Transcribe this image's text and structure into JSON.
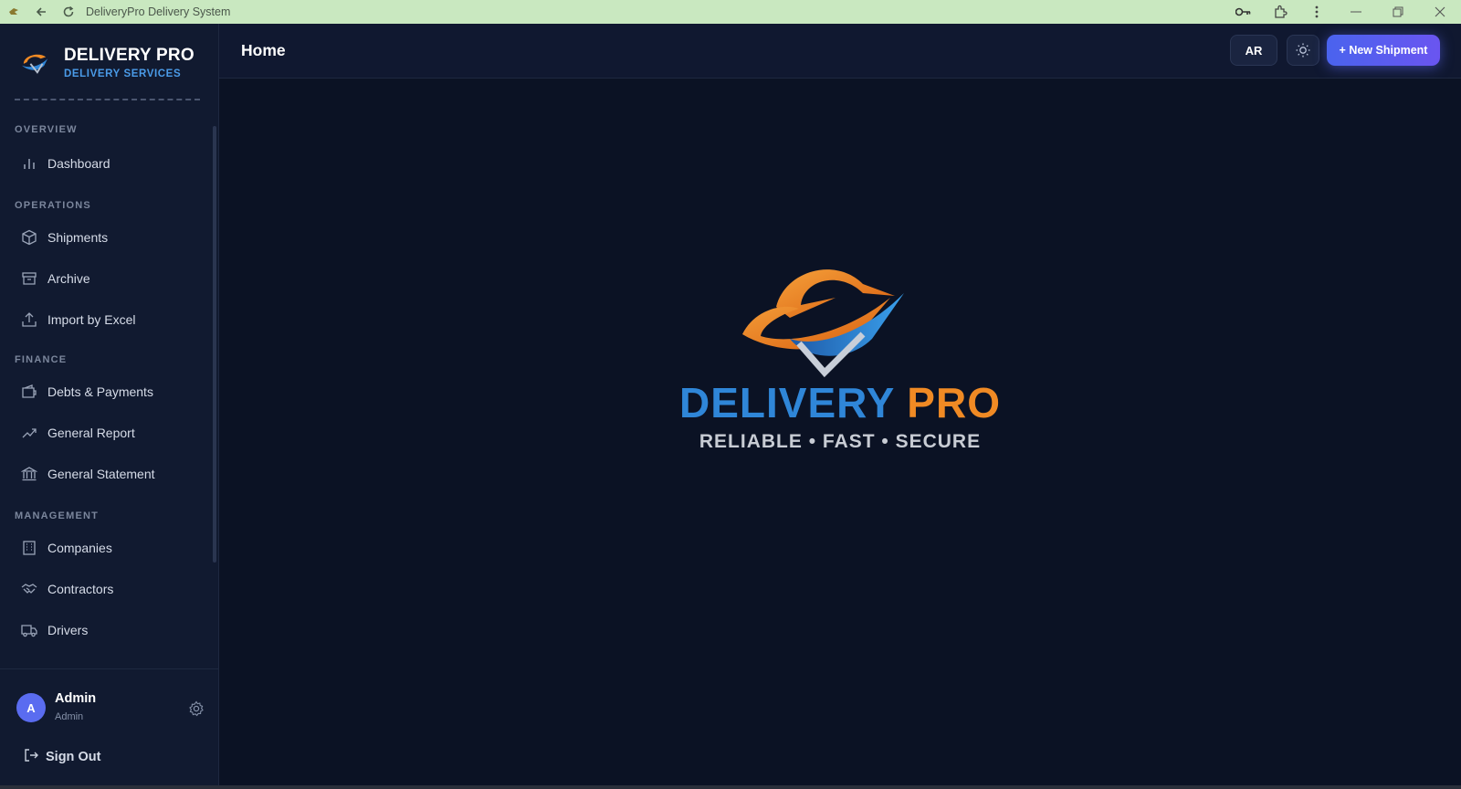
{
  "browser": {
    "title": "DeliveryPro Delivery System"
  },
  "brand": {
    "name": "DELIVERY PRO",
    "subtitle": "DELIVERY SERVICES"
  },
  "sidebar": {
    "sections": [
      {
        "label": "OVERVIEW",
        "items": [
          {
            "label": "Dashboard",
            "icon": "bar-chart-icon"
          }
        ]
      },
      {
        "label": "OPERATIONS",
        "items": [
          {
            "label": "Shipments",
            "icon": "box-icon"
          },
          {
            "label": "Archive",
            "icon": "archive-icon"
          },
          {
            "label": "Import by Excel",
            "icon": "upload-icon"
          }
        ]
      },
      {
        "label": "FINANCE",
        "items": [
          {
            "label": "Debts & Payments",
            "icon": "wallet-icon"
          },
          {
            "label": "General Report",
            "icon": "trending-up-icon"
          },
          {
            "label": "General Statement",
            "icon": "bank-icon"
          }
        ]
      },
      {
        "label": "MANAGEMENT",
        "items": [
          {
            "label": "Companies",
            "icon": "building-icon"
          },
          {
            "label": "Contractors",
            "icon": "handshake-icon"
          },
          {
            "label": "Drivers",
            "icon": "truck-icon"
          }
        ]
      }
    ]
  },
  "user": {
    "initial": "A",
    "name": "Admin",
    "role": "Admin",
    "signout_label": "Sign Out"
  },
  "header": {
    "title": "Home",
    "lang_label": "AR",
    "new_shipment_label": "+ New Shipment"
  },
  "hero": {
    "title_part1": "DELIVERY",
    "title_part2": "PRO",
    "tagline": "RELIABLE • FAST • SECURE"
  },
  "colors": {
    "accent": "#5a63f0",
    "brand_blue": "#2f86d8",
    "brand_orange": "#f08a24",
    "background": "#0b1224",
    "sidebar": "#111a30"
  }
}
